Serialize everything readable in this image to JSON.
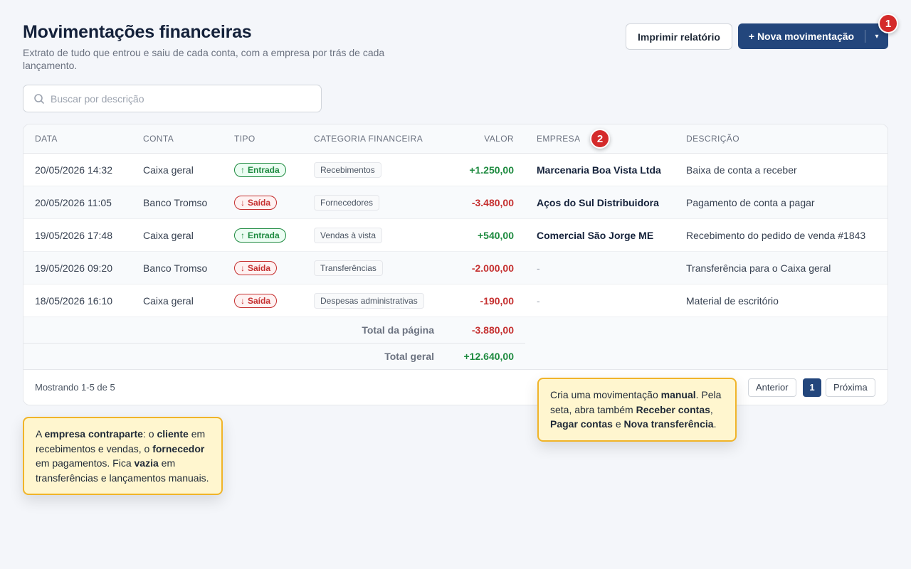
{
  "header": {
    "title": "Movimentações financeiras",
    "subtitle": "Extrato de tudo que entrou e saiu de cada conta, com a empresa por trás de cada lançamento.",
    "print_label": "Imprimir relatório",
    "new_label": "+ Nova movimentação",
    "caret": "▾"
  },
  "search": {
    "placeholder": "Buscar por descrição"
  },
  "table": {
    "columns": {
      "data": "DATA",
      "conta": "CONTA",
      "tipo": "TIPO",
      "categoria": "CATEGORIA FINANCEIRA",
      "valor": "VALOR",
      "empresa": "EMPRESA",
      "descricao": "DESCRIÇÃO"
    },
    "rows": [
      {
        "data": "20/05/2026 14:32",
        "conta": "Caixa geral",
        "tipo": "Entrada",
        "categoria": "Recebimentos",
        "valor": "+1.250,00",
        "empresa": "Marcenaria Boa Vista Ltda",
        "descricao": "Baixa de conta a receber"
      },
      {
        "data": "20/05/2026 11:05",
        "conta": "Banco Tromso",
        "tipo": "Saída",
        "categoria": "Fornecedores",
        "valor": "-3.480,00",
        "empresa": "Aços do Sul Distribuidora",
        "descricao": "Pagamento de conta a pagar"
      },
      {
        "data": "19/05/2026 17:48",
        "conta": "Caixa geral",
        "tipo": "Entrada",
        "categoria": "Vendas à vista",
        "valor": "+540,00",
        "empresa": "Comercial São Jorge ME",
        "descricao": "Recebimento do pedido de venda #1843"
      },
      {
        "data": "19/05/2026 09:20",
        "conta": "Banco Tromso",
        "tipo": "Saída",
        "categoria": "Transferências",
        "valor": "-2.000,00",
        "empresa": "-",
        "descricao": "Transferência para o Caixa geral"
      },
      {
        "data": "18/05/2026 16:10",
        "conta": "Caixa geral",
        "tipo": "Saída",
        "categoria": "Despesas administrativas",
        "valor": "-190,00",
        "empresa": "-",
        "descricao": "Material de escritório"
      }
    ],
    "totals": {
      "page_label": "Total da página",
      "page_value": "-3.880,00",
      "grand_label": "Total geral",
      "grand_value": "+12.640,00"
    }
  },
  "pagination": {
    "showing": "Mostrando 1-5 de 5",
    "prev": "Anterior",
    "current": "1",
    "next": "Próxima"
  },
  "badges": {
    "one": "1",
    "two": "2"
  },
  "tooltips": {
    "new": {
      "t1": "Cria uma movimentação ",
      "b1": "manual",
      "t2": ". Pela seta, abra também ",
      "b2": "Receber contas",
      "t3": ", ",
      "b3": "Pagar contas",
      "t4": " e ",
      "b4": "Nova transferência",
      "t5": "."
    },
    "empresa": {
      "t1": "A ",
      "b1": "empresa contraparte",
      "t2": ": o ",
      "b2": "cliente",
      "t3": " em recebimentos e vendas, o ",
      "b3": "fornecedor",
      "t4": " em pagamentos. Fica ",
      "b4": "vazia",
      "t5": " em transferências e lançamentos manuais."
    }
  },
  "colors": {
    "primary": "#23467c",
    "positive": "#1d8a3f",
    "negative": "#c53030",
    "badge": "#d42a2a",
    "tooltip_bg": "#fff6cf",
    "tooltip_border": "#f0b429"
  },
  "icons": {
    "search": "search-icon",
    "arrow_up": "arrow-up-icon",
    "arrow_down": "arrow-down-icon"
  }
}
